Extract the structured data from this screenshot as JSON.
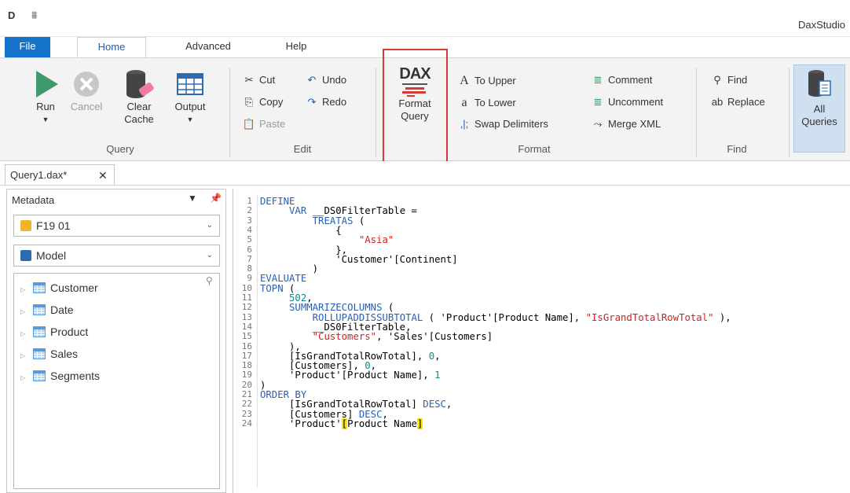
{
  "app": {
    "logo": "D",
    "title": "DaxStudio"
  },
  "tabs": [
    "File",
    "Home",
    "Advanced",
    "Help"
  ],
  "ribbon": {
    "query": {
      "run": "Run",
      "cancel": "Cancel",
      "clear": "Clear",
      "cache": "Cache",
      "output": "Output",
      "label": "Query"
    },
    "edit": {
      "cut": "Cut",
      "copy": "Copy",
      "paste": "Paste",
      "undo": "Undo",
      "redo": "Redo",
      "label": "Edit"
    },
    "format": {
      "format_query_1": "Format",
      "format_query_2": "Query",
      "dax_logo": "DAX",
      "to_upper": "To Upper",
      "to_lower": "To Lower",
      "swap": "Swap Delimiters",
      "comment": "Comment",
      "uncomment": "Uncomment",
      "merge_xml": "Merge XML",
      "label": "Format"
    },
    "find": {
      "find": "Find",
      "replace": "Replace",
      "label": "Find"
    },
    "all_queries_1": "All",
    "all_queries_2": "Queries"
  },
  "document_tab": {
    "name": "Query1.dax*",
    "close": "✕"
  },
  "metadata": {
    "title": "Metadata",
    "database": "F19 01",
    "model": "Model",
    "tables": [
      "Customer",
      "Date",
      "Product",
      "Sales",
      "Segments"
    ]
  },
  "editor": {
    "line_numbers": [
      "1",
      "2",
      "3",
      "4",
      "5",
      "6",
      "7",
      "8",
      "9",
      "10",
      "11",
      "12",
      "13",
      "14",
      "15",
      "16",
      "17",
      "18",
      "19",
      "20",
      "21",
      "22",
      "23",
      "24"
    ]
  },
  "colors": {
    "accent": "#1473c9",
    "highlight_box": "#d63a34",
    "keyword": "#2a5fb0",
    "string": "#d12121",
    "number": "#0a8a8a"
  }
}
